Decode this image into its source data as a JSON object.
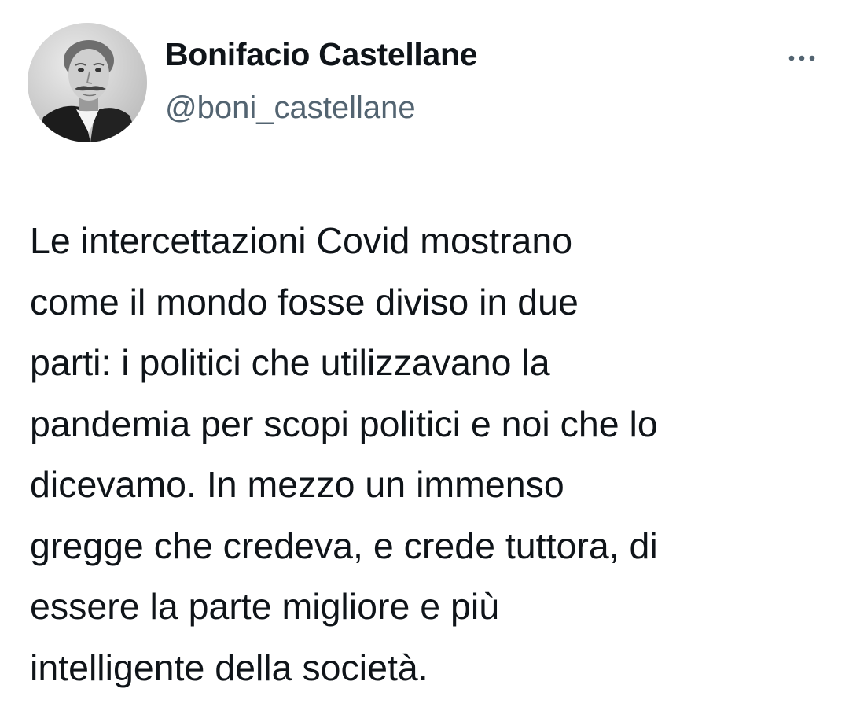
{
  "author": {
    "display_name": "Bonifacio Castellane",
    "handle": "@boni_castellane",
    "avatar_icon": "profile-photo"
  },
  "more_icon": "more-horizontal-icon",
  "tweet": {
    "lines": [
      "Le intercettazioni Covid mostrano",
      "come il mondo fosse diviso in due",
      "parti: i politici che utilizzavano la",
      "pandemia per scopi politici e noi che lo",
      "dicevamo. In mezzo un immenso",
      "gregge che credeva, e crede tuttora, di",
      "essere la parte migliore e più",
      "intelligente della società."
    ]
  },
  "colors": {
    "text_primary": "#0f1419",
    "text_secondary": "#536471",
    "background": "#ffffff"
  }
}
